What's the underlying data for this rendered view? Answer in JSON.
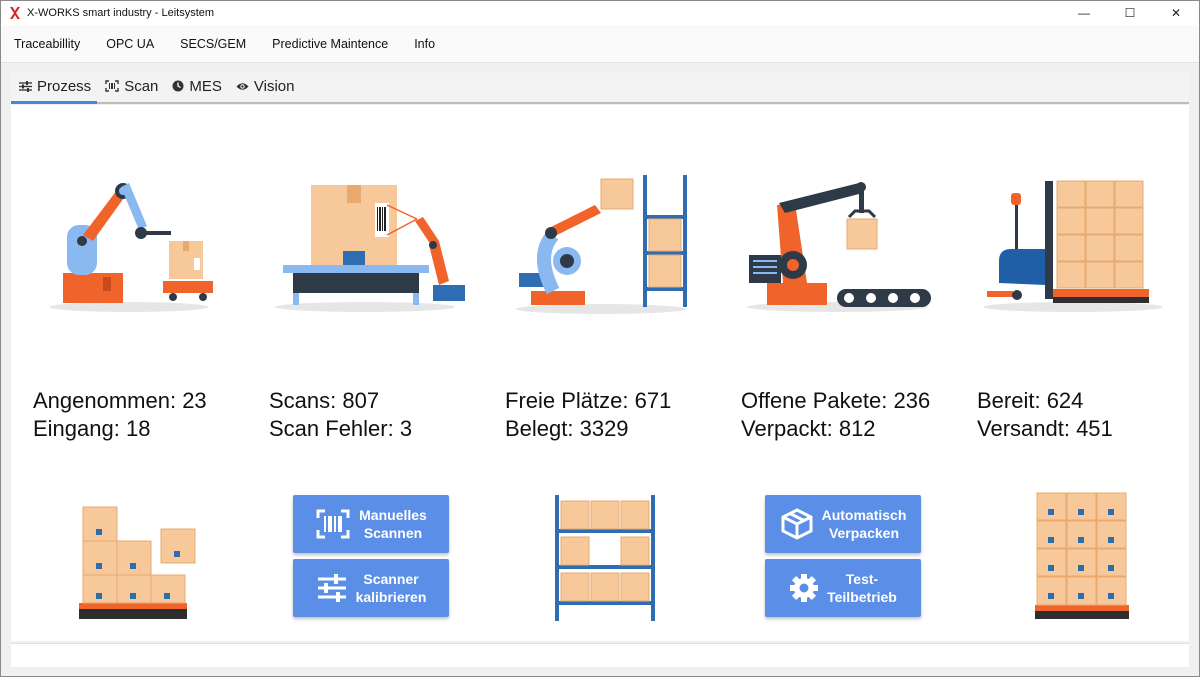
{
  "window": {
    "title": "X-WORKS smart industry - Leitsystem",
    "controls": {
      "minimize": "—",
      "maximize": "☐",
      "close": "✕"
    }
  },
  "menu": {
    "items": [
      "Traceabillity",
      "OPC UA",
      "SECS/GEM",
      "Predictive Maintence",
      "Info"
    ]
  },
  "tabs": [
    {
      "label": "Prozess",
      "icon": "sliders-icon",
      "active": true
    },
    {
      "label": "Scan",
      "icon": "barcode-scan-icon",
      "active": false
    },
    {
      "label": "MES",
      "icon": "clock-icon",
      "active": false
    },
    {
      "label": "Vision",
      "icon": "eye-icon",
      "active": false
    }
  ],
  "stations": [
    {
      "illustration": "robot-arm-agv",
      "line1": "Angenommen: 23",
      "line2": "Eingang: 18",
      "bottom": "stacked-boxes-pallet"
    },
    {
      "illustration": "conveyor-scanner",
      "line1": "Scans: 807",
      "line2": "Scan Fehler: 3",
      "bottom": "buttons"
    },
    {
      "illustration": "robot-shelf",
      "line1": "Freie Plätze: 671",
      "line2": "Belegt: 3329",
      "bottom": "shelf-rack"
    },
    {
      "illustration": "robot-packaging",
      "line1": "Offene Pakete: 236",
      "line2": "Verpackt: 812",
      "bottom": "buttons"
    },
    {
      "illustration": "forklift-pallet",
      "line1": "Bereit: 624",
      "line2": "Versandt: 451",
      "bottom": "full-pallet"
    }
  ],
  "buttons": {
    "manual_scan": "Manuelles\nScannen",
    "calibrate": "Scanner\nkalibrieren",
    "auto_pack": "Automatisch\nVerpacken",
    "test_run": "Test-\nTeilbetrieb"
  },
  "colors": {
    "accent": "#4a86d8",
    "button": "#5b8ee6",
    "robot_orange": "#f0632b",
    "robot_blue": "#8ab8f0",
    "box_tan": "#f6c89a",
    "dark": "#2e3a47"
  }
}
